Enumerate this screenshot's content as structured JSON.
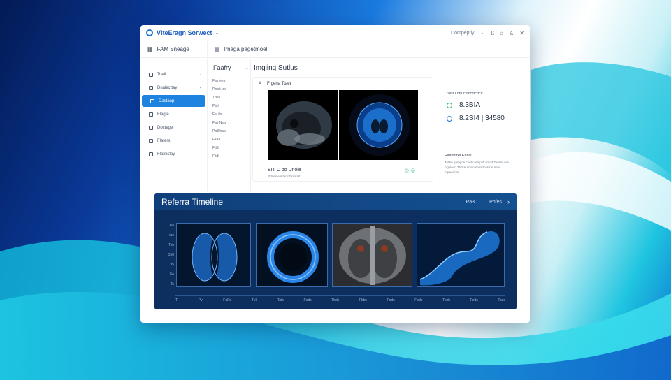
{
  "window": {
    "app_name": "VIteEragn Sorwect",
    "user": "Dompeptiy",
    "controls": [
      "ß",
      "⌂",
      "♙",
      "✕"
    ]
  },
  "subbar": {
    "left_label": "FAM Sneage",
    "right_label": "Imaga pagetmoel"
  },
  "sidebar": {
    "items": [
      {
        "label": "Toeli",
        "active": false
      },
      {
        "label": "Dualecttay",
        "active": false
      },
      {
        "label": "Dastaep",
        "active": true
      },
      {
        "label": "Flagte",
        "active": false
      },
      {
        "label": "Doctege",
        "active": false
      },
      {
        "label": "Flaters",
        "active": false
      },
      {
        "label": "Flaktistay",
        "active": false
      }
    ]
  },
  "col2": {
    "heading": "Faafry",
    "items": [
      "Fatrfees",
      "Poatt tos",
      "Tdali",
      "Pbtlt",
      "Fal lts",
      "Fati Nete",
      "Pa'Bhale",
      "Fsaa",
      "Ftblt",
      "Fitdi"
    ]
  },
  "panel": {
    "title": "Imgiing Sutlus"
  },
  "imaging": {
    "marker": "A",
    "title": "Frgena Ttaet",
    "caption": "EIT C bo Dnoie",
    "subcaption": "Rdnesteal tenclblodcslt"
  },
  "metrics": {
    "label": "Lraisl  Lotu clanmtcdcir",
    "values": [
      "8.3BIA",
      "8.2SI4 | 34580"
    ],
    "sub_title": "Feerfstrel Eatlal",
    "sub_text": "Taltkn gamgne cnet cortnpldl lsrjod Teotlal oes cigeloon Thdce rlnoin nnssdcos tar neyc Fgreoitore"
  },
  "timeline": {
    "title": "Referra Timeline",
    "btn1": "Pa3",
    "btn2": "Pofes",
    "yticks": [
      "Ra",
      "iao",
      "Tso",
      "150",
      "95",
      "Fo",
      "To"
    ],
    "xticks": [
      "Tl",
      "Pvl",
      "FaDs",
      "Tv3",
      "Tats",
      "Fods",
      "Tbds",
      "Fbbs",
      "Fods",
      "Fods",
      "Tbds",
      "Fods",
      "Tads"
    ]
  },
  "colors": {
    "accent": "#1d82e0",
    "timeline_bg": "#0c2f5f",
    "status_green": "#2fb47d"
  },
  "icons": {
    "logo": "circle-logo-icon",
    "ring": "status-ring-icon"
  }
}
